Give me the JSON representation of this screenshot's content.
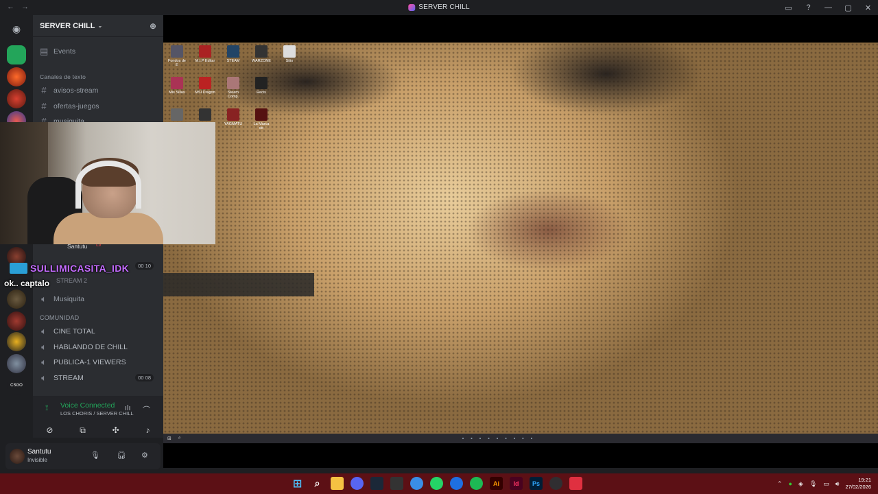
{
  "window": {
    "title": "SERVER CHILL",
    "nav_back": "←",
    "nav_fwd": "→"
  },
  "titlebar_icons": {
    "inbox": "inbox-icon",
    "help": "?",
    "min": "—",
    "max": "▢",
    "close": "✕"
  },
  "server": {
    "name": "SERVER CHILL",
    "chevron": "⌄",
    "invite": "👤+"
  },
  "channels_top": {
    "events": "Events",
    "category": "Canales de texto",
    "text": [
      "avisos-stream",
      "ofertas-juegos",
      "musiquita"
    ]
  },
  "voice_partial": {
    "user": "Santutu",
    "user_tag": "LV",
    "stream_badge": "00 10",
    "stream2": "STREAM 2",
    "musiquita": "Musiquita"
  },
  "community": {
    "category": "COMUNIDAD",
    "channels": [
      "CINE TOTAL",
      "HABLANDO DE CHILL",
      "PUBLICA-1 VIEWERS",
      "STREAM"
    ],
    "stream_badge": "00 08"
  },
  "voice_status": {
    "connected": "Voice Connected",
    "sub": "LOS CHORIS / SERVER CHILL"
  },
  "user": {
    "name": "Santutu",
    "status": "Invisible"
  },
  "overlay": {
    "chat_name": "SULLIMICASITA_IDK",
    "chat_msg": "ok.. captalo"
  },
  "taskbar": {
    "time": "19:21",
    "date": "27/02/2026"
  },
  "desktop_icons": [
    "Fondos de E",
    "M.I.P Editar",
    "STEAM",
    "WARZONE",
    "Sitio",
    "Mis Sillas",
    "MSI Dragon",
    "Steam Comp.",
    "Recis",
    "",
    "",
    "YAGMATU",
    "La Marca de"
  ]
}
